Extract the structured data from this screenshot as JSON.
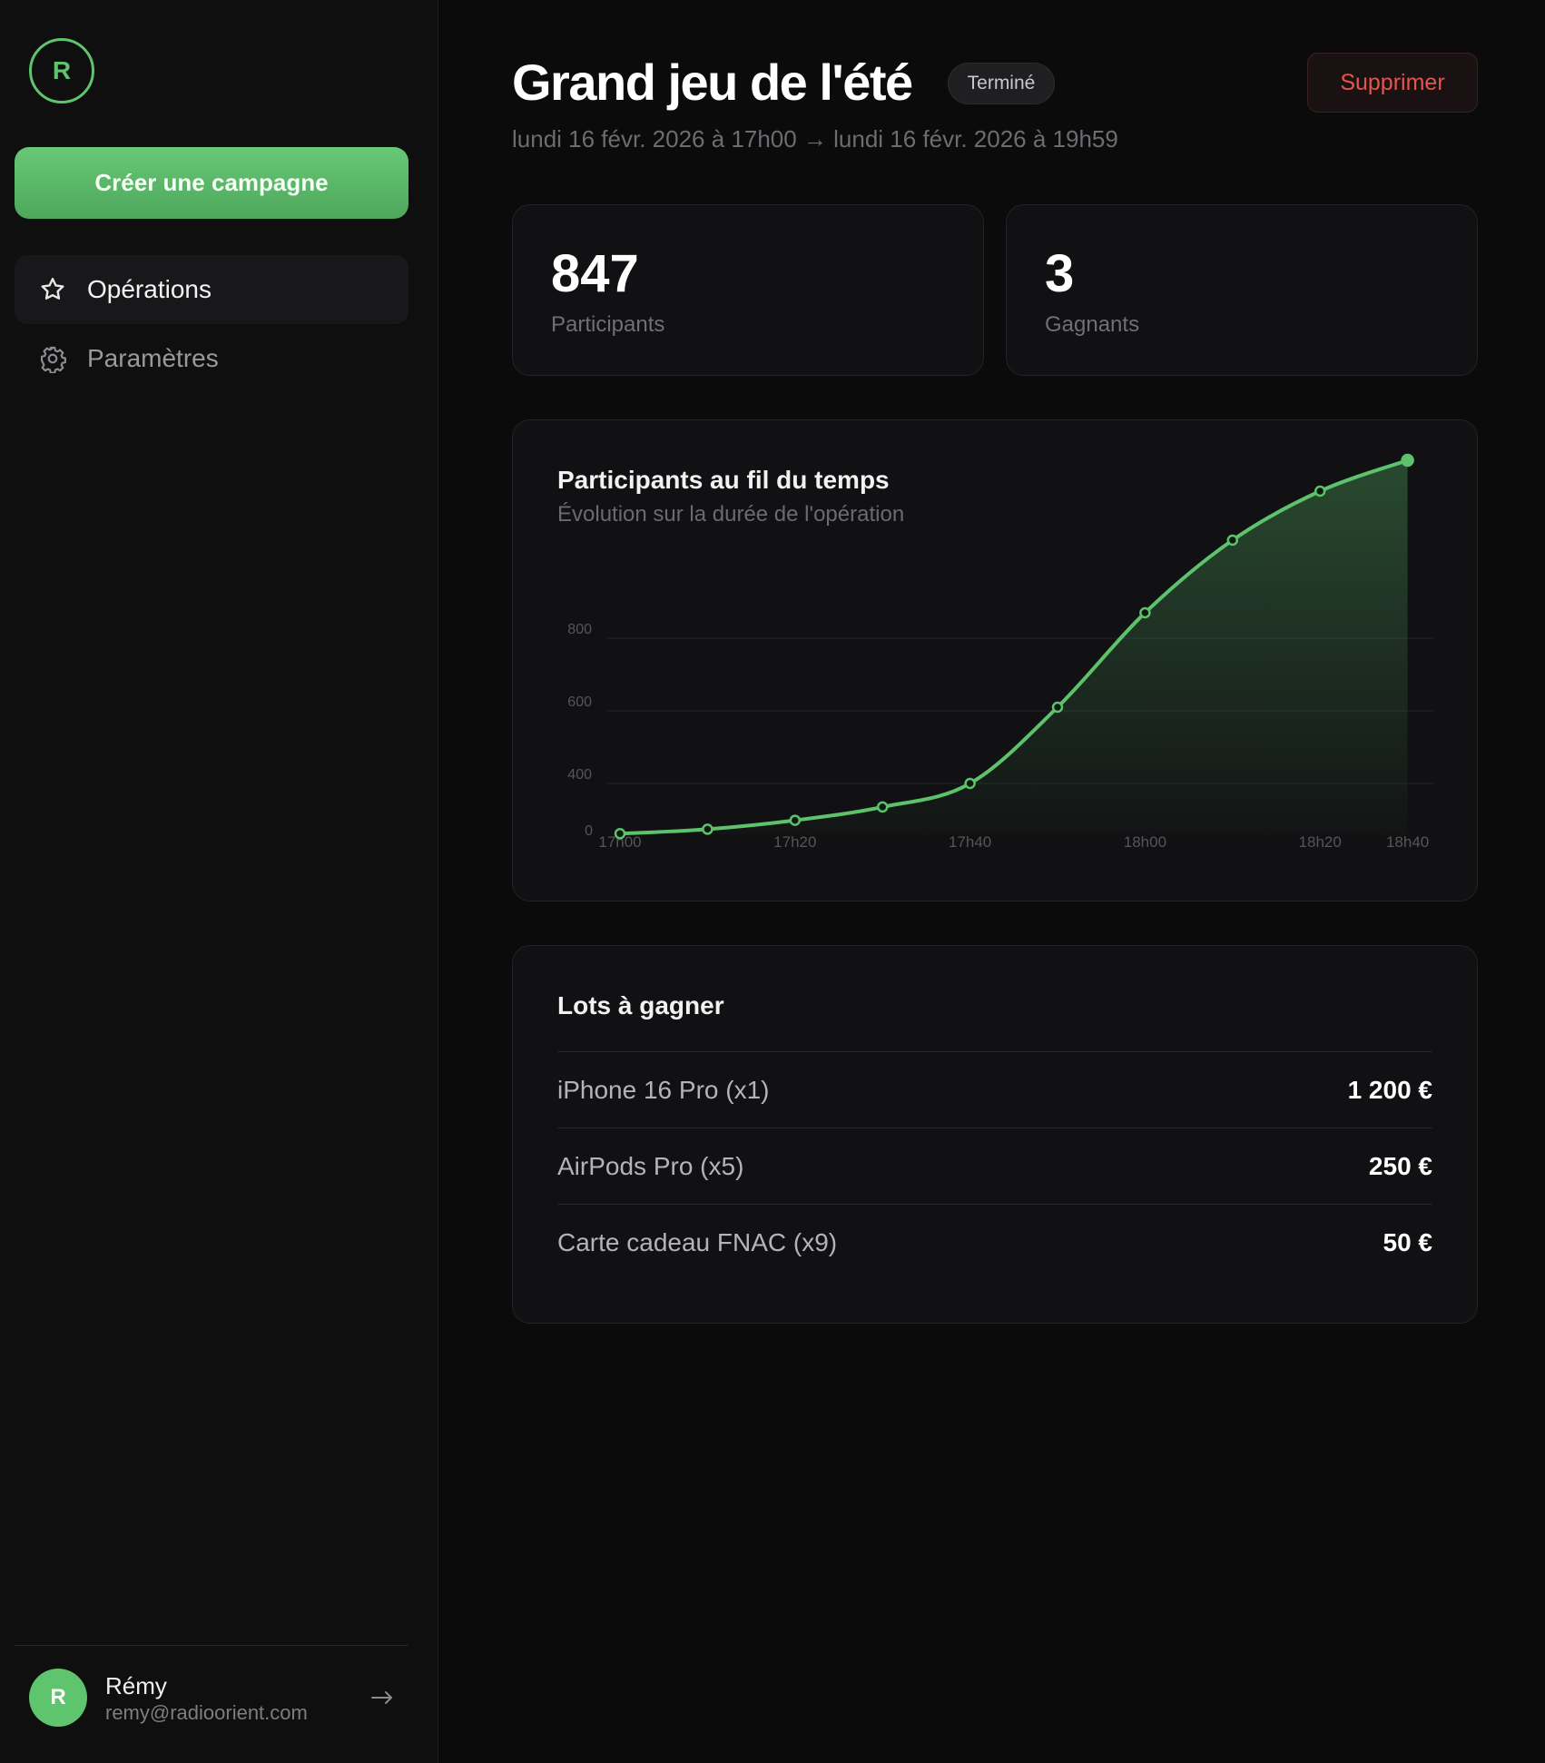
{
  "sidebar": {
    "logo_letter": "R",
    "create_button": "Créer une campagne",
    "nav": [
      {
        "label": "Opérations",
        "icon": "star-icon",
        "active": true
      },
      {
        "label": "Paramètres",
        "icon": "gear-icon",
        "active": false
      }
    ],
    "user": {
      "initial": "R",
      "name": "Rémy",
      "email": "remy@radioorient.com"
    }
  },
  "header": {
    "title": "Grand jeu de l'été",
    "status": "Terminé",
    "delete_button": "Supprimer",
    "date_range": "lundi 16 févr. 2026 à 17h00 → lundi 16 févr. 2026 à 19h59"
  },
  "stats": [
    {
      "value": "847",
      "label": "Participants"
    },
    {
      "value": "3",
      "label": "Gagnants"
    }
  ],
  "chart": {
    "title": "Participants au fil du temps",
    "subtitle": "Évolution sur la durée de l'opération"
  },
  "chart_data": {
    "type": "area",
    "title": "Participants au fil du temps",
    "subtitle": "Évolution sur la durée de l'opération",
    "x_ticks": [
      "17h00",
      "17h20",
      "17h40",
      "18h00",
      "18h20",
      "18h40"
    ],
    "y_ticks": [
      0,
      400,
      600,
      800
    ],
    "x_minutes": [
      0,
      10,
      20,
      30,
      40,
      50,
      60,
      70,
      80,
      90
    ],
    "values": [
      5,
      40,
      110,
      215,
      400,
      610,
      870,
      1070,
      1205,
      1290
    ],
    "xlabel": "",
    "ylabel": "",
    "grid": true,
    "color": "#5cc26c"
  },
  "prizes": {
    "title": "Lots à gagner",
    "items": [
      {
        "name": "iPhone 16 Pro (x1)",
        "value": "1 200 €"
      },
      {
        "name": "AirPods Pro (x5)",
        "value": "250 €"
      },
      {
        "name": "Carte cadeau FNAC (x9)",
        "value": "50 €"
      }
    ]
  }
}
